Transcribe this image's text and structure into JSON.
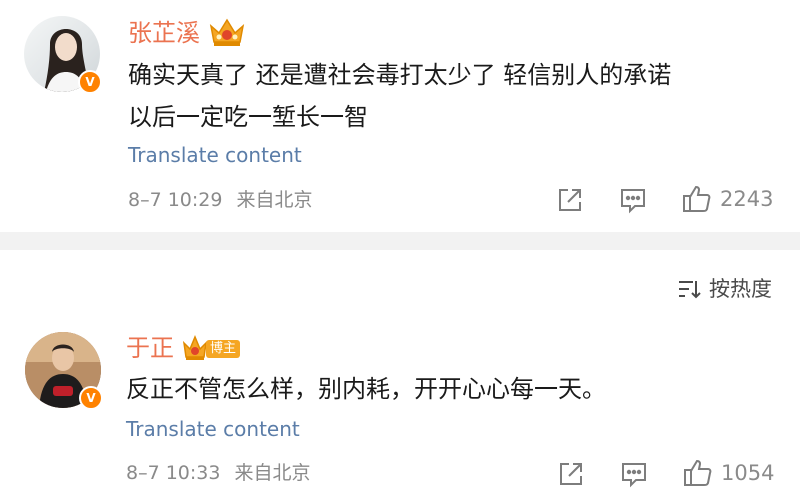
{
  "comments": [
    {
      "username": "张芷溪",
      "verified_badge": "V",
      "content_lines": [
        "确实天真了 还是遭社会毒打太少了 轻信别人的承诺",
        "以后一定吃一堑长一智"
      ],
      "translate_label": "Translate content",
      "timestamp": "8–7 10:29",
      "location": "来自北京",
      "likes": "2243"
    },
    {
      "username": "于正",
      "verified_badge": "V",
      "blogger_tag": "博主",
      "content_lines": [
        "反正不管怎么样，别内耗，开开心心每一天。"
      ],
      "translate_label": "Translate content",
      "timestamp": "8–7 10:33",
      "location": "来自北京",
      "likes": "1054"
    }
  ],
  "sort": {
    "label": "按热度",
    "icon": "sort-icon"
  },
  "icons": {
    "share": "share-icon",
    "comment": "comment-icon",
    "like": "thumbs-up-icon",
    "crown": "crown-icon"
  },
  "colors": {
    "username": "#eb7350",
    "link": "#5b7da8",
    "badge": "#ff8200",
    "meta": "#8a8a8a",
    "divider": "#f2f2f2"
  }
}
